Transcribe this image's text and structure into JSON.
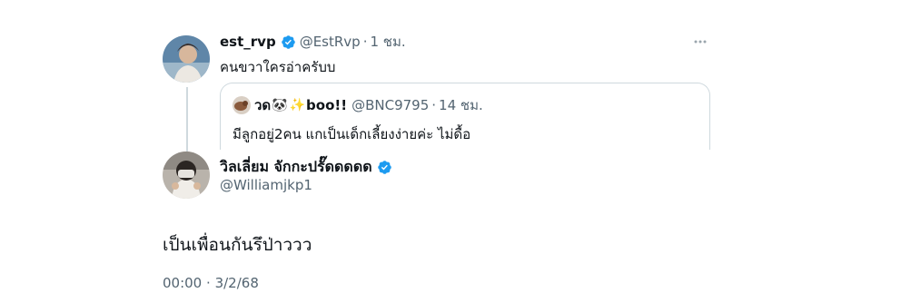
{
  "original_tweet": {
    "display_name": "est_rvp",
    "handle": "@EstRvp",
    "separator": "·",
    "time": "1 ชม.",
    "text": "คนขวาใครอ่าครับบ",
    "verified_icon": "verified-badge-icon",
    "more_icon": "more-options-icon"
  },
  "quoted_tweet": {
    "display_name_prefix": "วด",
    "emoji_1": "🐼",
    "emoji_2": "✨",
    "display_name_suffix": "boo!!",
    "handle": "@BNC9795",
    "separator": "·",
    "time": "14 ชม.",
    "text": "มีลูกอยู่2คน แกเป็นเด็กเลี้ยงง่ายค่ะ ไม่ดื้อ"
  },
  "reply": {
    "display_name": "วิลเลี่ยม จักกะปรั๊ดดดดด",
    "handle": "@Williamjkp1",
    "text": "เป็นเพื่อนกันรึป่าววว",
    "time": "00:00",
    "separator": "·",
    "date": "3/2/68"
  },
  "colors": {
    "verified": "#1d9bf0",
    "muted": "#536471",
    "border": "#cfd9de"
  }
}
